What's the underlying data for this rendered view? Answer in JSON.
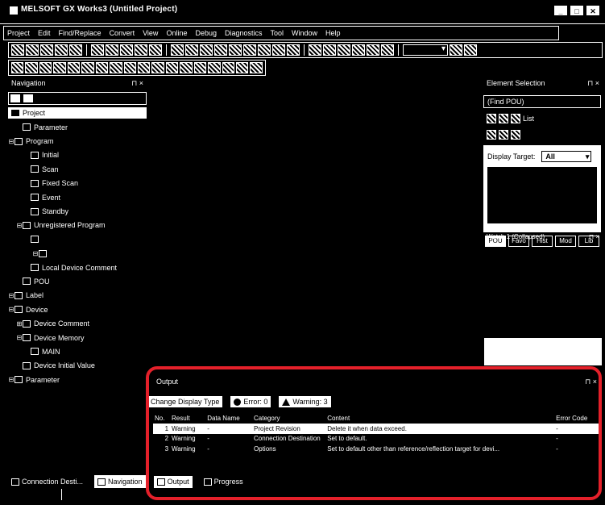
{
  "window": {
    "title": "MELSOFT GX Works3 (Untitled Project)",
    "buttons": [
      "_",
      "□",
      "✕"
    ]
  },
  "menu": [
    "Project",
    "Edit",
    "Find/Replace",
    "Convert",
    "View",
    "Online",
    "Debug",
    "Diagnostics",
    "Tool",
    "Window",
    "Help"
  ],
  "navigation": {
    "header": "Navigation",
    "pin": "⊓ ×",
    "project_label": "Project",
    "tree": [
      {
        "indent": 1,
        "twist": "",
        "label": "Parameter"
      },
      {
        "indent": 0,
        "twist": "⊟",
        "label": "Program"
      },
      {
        "indent": 2,
        "twist": "",
        "label": "Initial"
      },
      {
        "indent": 2,
        "twist": "",
        "label": "Scan"
      },
      {
        "indent": 2,
        "twist": "",
        "label": "Fixed Scan"
      },
      {
        "indent": 2,
        "twist": "",
        "label": "Event"
      },
      {
        "indent": 2,
        "twist": "",
        "label": "Standby"
      },
      {
        "indent": 1,
        "twist": "⊟",
        "label": "Unregistered Program"
      },
      {
        "indent": 2,
        "twist": "",
        "label": ""
      },
      {
        "indent": 3,
        "twist": "⊟",
        "label": ""
      },
      {
        "indent": 2,
        "twist": "",
        "label": "Local Device Comment"
      },
      {
        "indent": 1,
        "twist": "",
        "label": "POU"
      },
      {
        "indent": 0,
        "twist": "⊟",
        "label": "Label"
      },
      {
        "indent": 0,
        "twist": "⊟",
        "label": "Device"
      },
      {
        "indent": 1,
        "twist": "⊞",
        "label": "Device Comment"
      },
      {
        "indent": 1,
        "twist": "⊟",
        "label": "Device Memory"
      },
      {
        "indent": 2,
        "twist": "",
        "label": "MAIN"
      },
      {
        "indent": 1,
        "twist": "",
        "label": "Device Initial Value"
      },
      {
        "indent": 0,
        "twist": "⊟",
        "label": "Parameter"
      }
    ]
  },
  "right_panel": {
    "header": "Element Selection",
    "pin": "⊓ ×",
    "find_field": "(Find POU)",
    "tools_label": "List",
    "display_target_label": "Display Target:",
    "display_target_value": "All",
    "tab_buttons": [
      "POU",
      "Favo",
      "Hist",
      "Mod",
      "Lib"
    ],
    "sub_header": "Watch 1 (Collapsed)",
    "sub_pin": "⊓ ×"
  },
  "output": {
    "header": "Output",
    "pin": "⊓ ×",
    "change_label": "Change Display Type",
    "error_label": "Error: 0",
    "warning_label": "Warning: 3",
    "columns": [
      "No.",
      "Result",
      "Data Name",
      "Category",
      "Content",
      "Error Code"
    ],
    "rows": [
      {
        "no": "1",
        "result": "Warning",
        "data": "-",
        "category": "Project Revision",
        "content": "Delete it when data exceed.",
        "error": "-"
      },
      {
        "no": "2",
        "result": "Warning",
        "data": "-",
        "category": "Connection Destination",
        "content": "Set to default.",
        "error": "-"
      },
      {
        "no": "3",
        "result": "Warning",
        "data": "-",
        "category": "Options",
        "content": "Set to default other than reference/reflection target for devi...",
        "error": "-"
      }
    ]
  },
  "bottom_tabs": [
    "Connection Desti...",
    "Navigation",
    "Output",
    "Progress"
  ],
  "colors": {
    "annotation": "#e4202a",
    "background": "#000000",
    "foreground": "#ffffff"
  }
}
